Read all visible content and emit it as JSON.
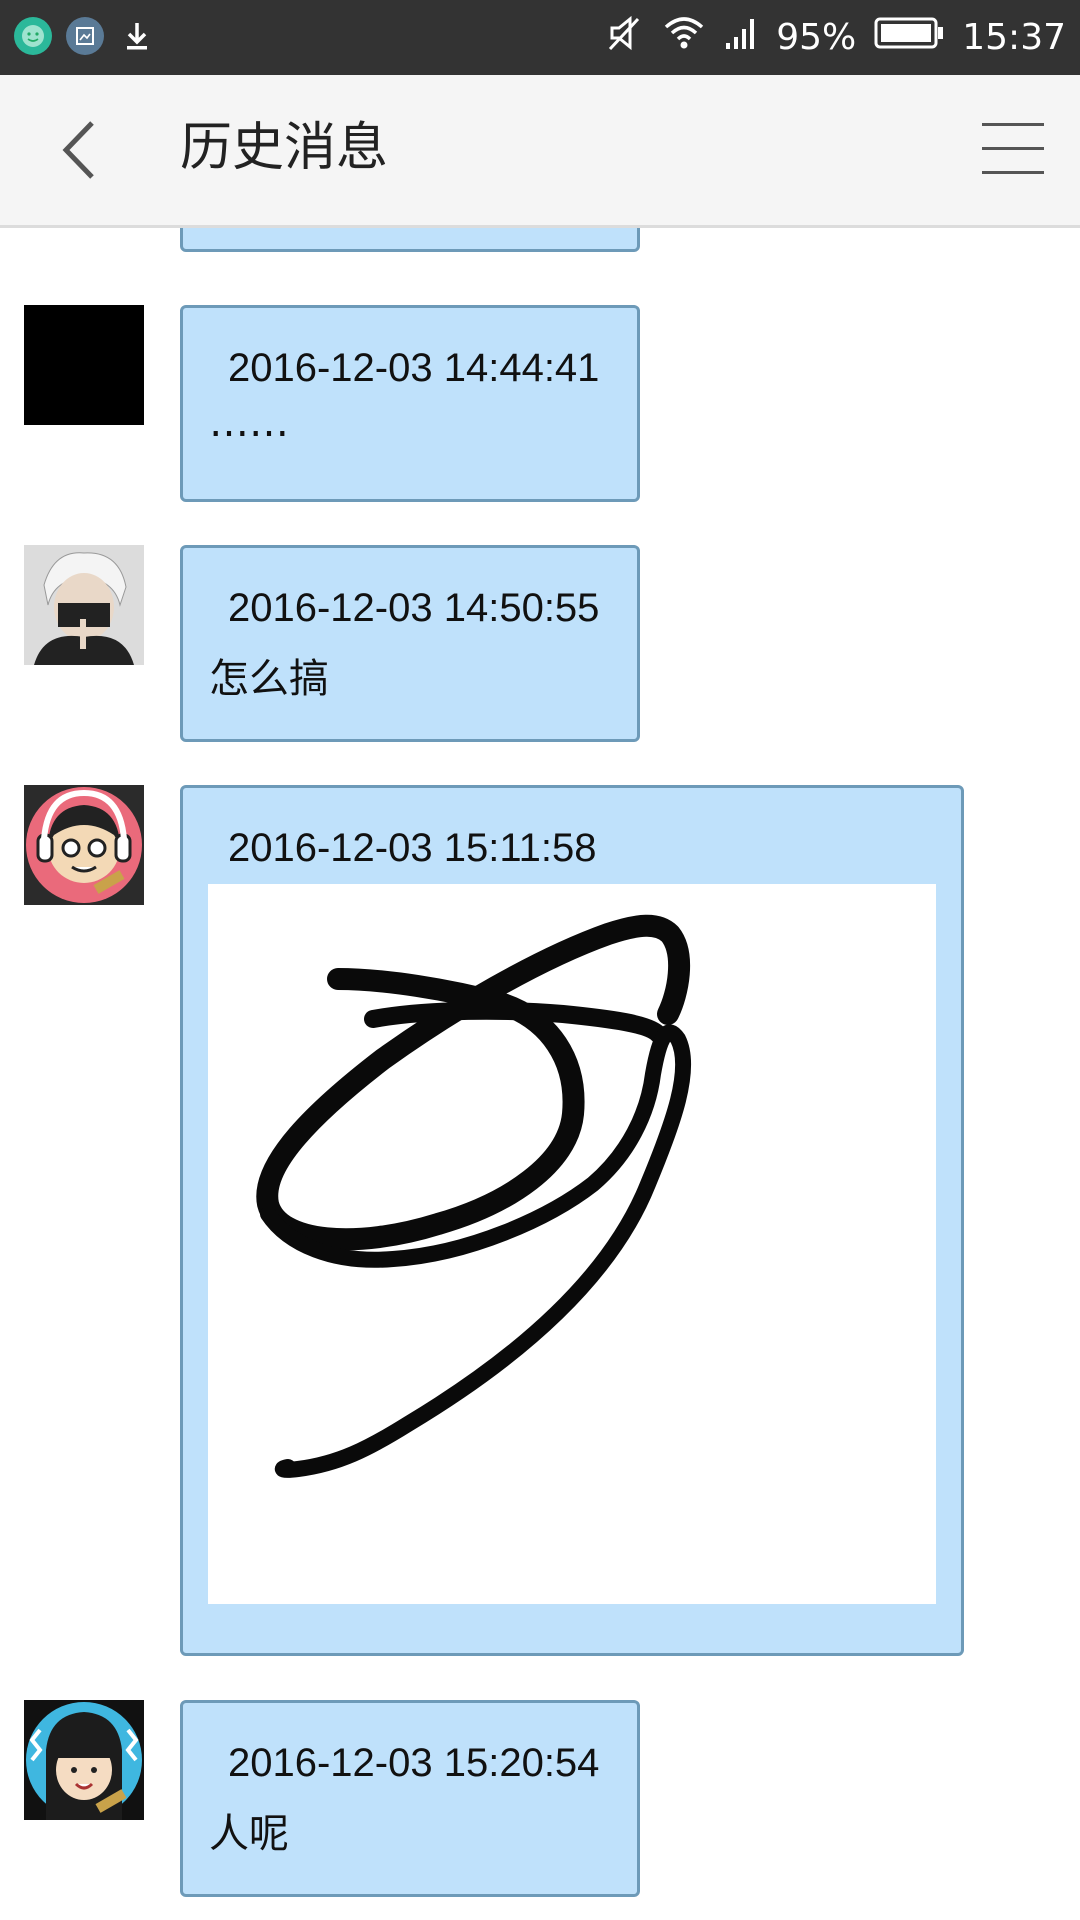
{
  "status_bar": {
    "battery": "95%",
    "time": "15:37"
  },
  "header": {
    "title": "历史消息",
    "back_icon": "chevron-left-icon",
    "menu_icon": "hamburger-menu-icon"
  },
  "messages": [
    {
      "timestamp": "2016-12-03 14:44:41",
      "text": "……",
      "avatar": "black-square"
    },
    {
      "timestamp": "2016-12-03 14:50:55",
      "text": "怎么搞",
      "avatar": "masked-anime-character"
    },
    {
      "timestamp": "2016-12-03 15:11:58",
      "text": "",
      "avatar": "headphones-cartoon",
      "attachment": "handwritten-drawing"
    },
    {
      "timestamp": "2016-12-03 15:20:54",
      "text": "人呢",
      "avatar": "bangs-cartoon-girl"
    }
  ],
  "colors": {
    "status_bar": "#333333",
    "app_bar": "#f5f5f5",
    "bubble_fill": "#bfe1fb",
    "bubble_border": "#6d9ab8"
  }
}
